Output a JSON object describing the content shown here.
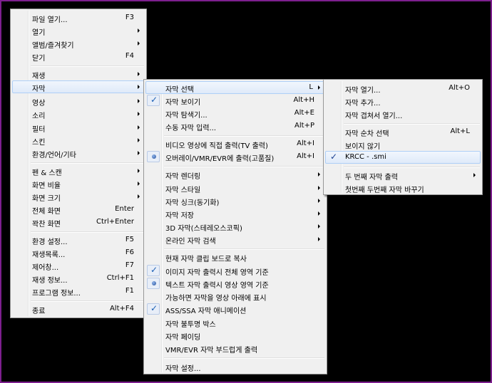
{
  "menu1": {
    "items": [
      {
        "label": "파일 열기...",
        "shortcut": "F3",
        "arrow": false
      },
      {
        "label": "열기",
        "shortcut": "",
        "arrow": true
      },
      {
        "label": "앨범/즐겨찾기",
        "shortcut": "",
        "arrow": true
      },
      {
        "label": "닫기",
        "shortcut": "F4",
        "arrow": false
      },
      {
        "label": "재생",
        "shortcut": "",
        "arrow": true
      },
      {
        "label": "자막",
        "shortcut": "",
        "arrow": true
      },
      {
        "label": "영상",
        "shortcut": "",
        "arrow": true
      },
      {
        "label": "소리",
        "shortcut": "",
        "arrow": true
      },
      {
        "label": "필터",
        "shortcut": "",
        "arrow": true
      },
      {
        "label": "스킨",
        "shortcut": "",
        "arrow": true
      },
      {
        "label": "환경/언어/기타",
        "shortcut": "",
        "arrow": true
      },
      {
        "label": "펜 & 스캔",
        "shortcut": "",
        "arrow": true
      },
      {
        "label": "화면 비율",
        "shortcut": "",
        "arrow": true
      },
      {
        "label": "화면 크기",
        "shortcut": "",
        "arrow": true
      },
      {
        "label": "전체 화면",
        "shortcut": "Enter",
        "arrow": false
      },
      {
        "label": "꽉찬 화면",
        "shortcut": "Ctrl+Enter",
        "arrow": false
      },
      {
        "label": "환경 설정...",
        "shortcut": "F5",
        "arrow": false
      },
      {
        "label": "재생목록...",
        "shortcut": "F6",
        "arrow": false
      },
      {
        "label": "제어창...",
        "shortcut": "F7",
        "arrow": false
      },
      {
        "label": "재생 정보...",
        "shortcut": "Ctrl+F1",
        "arrow": false
      },
      {
        "label": "프로그램 정보...",
        "shortcut": "F1",
        "arrow": false
      },
      {
        "label": "종료",
        "shortcut": "Alt+F4",
        "arrow": false
      }
    ]
  },
  "menu2": {
    "items": [
      {
        "label": "자막 선택",
        "shortcut": "L",
        "arrow": true
      },
      {
        "label": "자막 보이기",
        "shortcut": "Alt+H",
        "arrow": false,
        "mark": "check"
      },
      {
        "label": "자막 탐색기...",
        "shortcut": "Alt+E",
        "arrow": false
      },
      {
        "label": "수동 자막 입력...",
        "shortcut": "Alt+P",
        "arrow": false
      },
      {
        "label": "비디오 영상에 직접 출력(TV 출력)",
        "shortcut": "Alt+I",
        "arrow": false
      },
      {
        "label": "오버레이/VMR/EVR에 출력(고품질)",
        "shortcut": "Alt+I",
        "arrow": false,
        "mark": "bullet"
      },
      {
        "label": "자막 렌더링",
        "shortcut": "",
        "arrow": true
      },
      {
        "label": "자막 스타일",
        "shortcut": "",
        "arrow": true
      },
      {
        "label": "자막 싱크(동기화)",
        "shortcut": "",
        "arrow": true
      },
      {
        "label": "자막 저장",
        "shortcut": "",
        "arrow": true
      },
      {
        "label": "3D 자막(스테레오스코픽)",
        "shortcut": "",
        "arrow": true
      },
      {
        "label": "온라인 자막 검색",
        "shortcut": "",
        "arrow": true
      },
      {
        "label": "현재 자막 클립 보드로 복사",
        "shortcut": "",
        "arrow": false
      },
      {
        "label": "이미지 자막 출력시 전체 영역 기준",
        "shortcut": "",
        "arrow": false,
        "mark": "check"
      },
      {
        "label": "텍스트 자막 출력시 영상 영역 기준",
        "shortcut": "",
        "arrow": false,
        "mark": "bullet"
      },
      {
        "label": "가능하면 자막을 영상 아래에 표시",
        "shortcut": "",
        "arrow": false
      },
      {
        "label": "ASS/SSA 자막 애니메이션",
        "shortcut": "",
        "arrow": false,
        "mark": "check"
      },
      {
        "label": "자막 불투명 박스",
        "shortcut": "",
        "arrow": false
      },
      {
        "label": "자막 페이딩",
        "shortcut": "",
        "arrow": false
      },
      {
        "label": "VMR/EVR 자막 부드럽게 출력",
        "shortcut": "",
        "arrow": false
      },
      {
        "label": "자막 설정...",
        "shortcut": "",
        "arrow": false
      }
    ]
  },
  "menu3": {
    "items": [
      {
        "label": "자막 열기...",
        "shortcut": "Alt+O",
        "arrow": false
      },
      {
        "label": "자막 추가...",
        "shortcut": "",
        "arrow": false
      },
      {
        "label": "자막 겹쳐서 열기...",
        "shortcut": "",
        "arrow": false
      },
      {
        "label": "자막 순차 선택",
        "shortcut": "Alt+L",
        "arrow": false
      },
      {
        "label": "보이지 않기",
        "shortcut": "",
        "arrow": false
      },
      {
        "label": "KRCC - .smi",
        "shortcut": "",
        "arrow": false,
        "mark": "check"
      },
      {
        "label": "두 번째 자막 출력",
        "shortcut": "",
        "arrow": true
      },
      {
        "label": "첫번째 두번째 자막 바꾸기",
        "shortcut": "",
        "arrow": false
      }
    ]
  }
}
